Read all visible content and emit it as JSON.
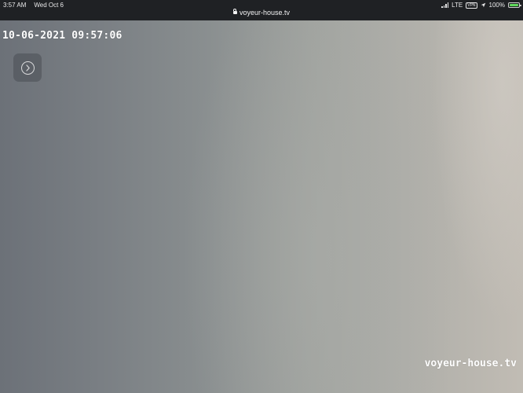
{
  "status_bar": {
    "time": "3:57 AM",
    "date": "Wed Oct 6",
    "url": "voyeur-house.tv",
    "network": "LTE",
    "vpn": "VPN",
    "battery": "100%"
  },
  "video": {
    "timestamp": "10-06-2021 09:57:06",
    "watermark": "voyeur-house.tv"
  }
}
